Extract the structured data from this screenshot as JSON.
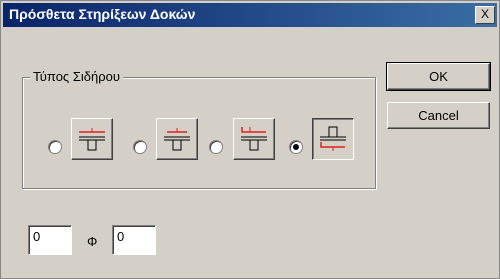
{
  "dialog": {
    "title": "Πρόσθετα Στηρίξεων Δοκών",
    "close_label": "X"
  },
  "group": {
    "label": "Τύπος Σιδήρου",
    "options": [
      {
        "checked": false,
        "icon": "rebar-top-icon"
      },
      {
        "checked": false,
        "icon": "rebar-top-short-icon"
      },
      {
        "checked": false,
        "icon": "rebar-top-hook-icon"
      },
      {
        "checked": true,
        "icon": "rebar-bottom-icon"
      }
    ]
  },
  "buttons": {
    "ok": "OK",
    "cancel": "Cancel"
  },
  "inputs": {
    "left_value": "0",
    "separator": "Φ",
    "right_value": "0"
  },
  "colors": {
    "accent_red": "#e0201a",
    "title_bar": "#0a246a"
  }
}
